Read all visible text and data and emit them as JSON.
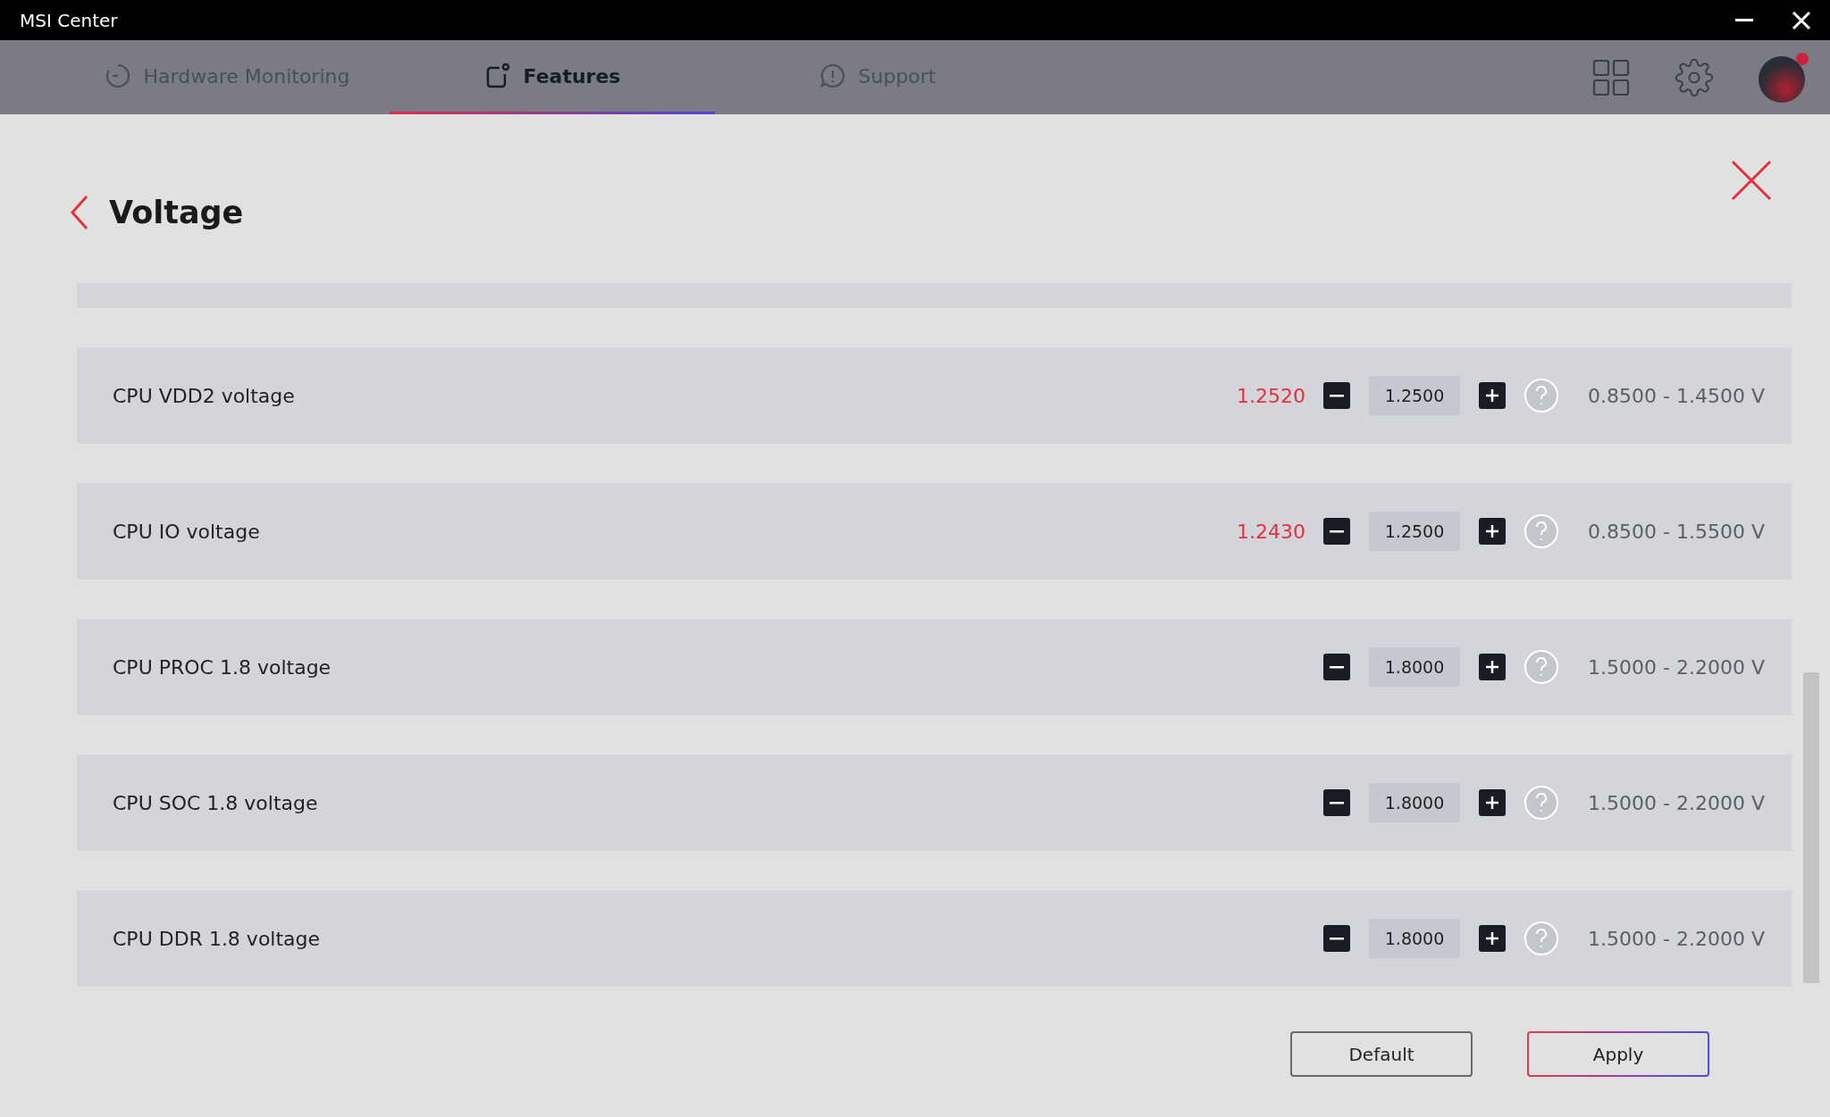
{
  "window": {
    "title": "MSI Center"
  },
  "tabs": [
    {
      "label": "Hardware Monitoring",
      "selected": false
    },
    {
      "label": "Features",
      "selected": true
    },
    {
      "label": "Support",
      "selected": false
    }
  ],
  "avatar": {
    "notification": true
  },
  "page": {
    "title": "Voltage"
  },
  "rows": [
    {
      "name": "CPU VDD2 voltage",
      "current": "1.2520",
      "value": "1.2500",
      "range": "0.8500 - 1.4500 V"
    },
    {
      "name": "CPU IO voltage",
      "current": "1.2430",
      "value": "1.2500",
      "range": "0.8500 - 1.5500 V"
    },
    {
      "name": "CPU PROC 1.8 voltage",
      "value": "1.8000",
      "range": "1.5000 - 2.2000 V"
    },
    {
      "name": "CPU SOC 1.8 voltage",
      "value": "1.8000",
      "range": "1.5000 - 2.2000 V"
    },
    {
      "name": "CPU DDR 1.8 voltage",
      "value": "1.8000",
      "range": "1.5000 - 2.2000 V"
    }
  ],
  "buttons": [
    {
      "label": "Default",
      "kind": "secondary"
    },
    {
      "label": "Apply",
      "kind": "primary"
    }
  ]
}
